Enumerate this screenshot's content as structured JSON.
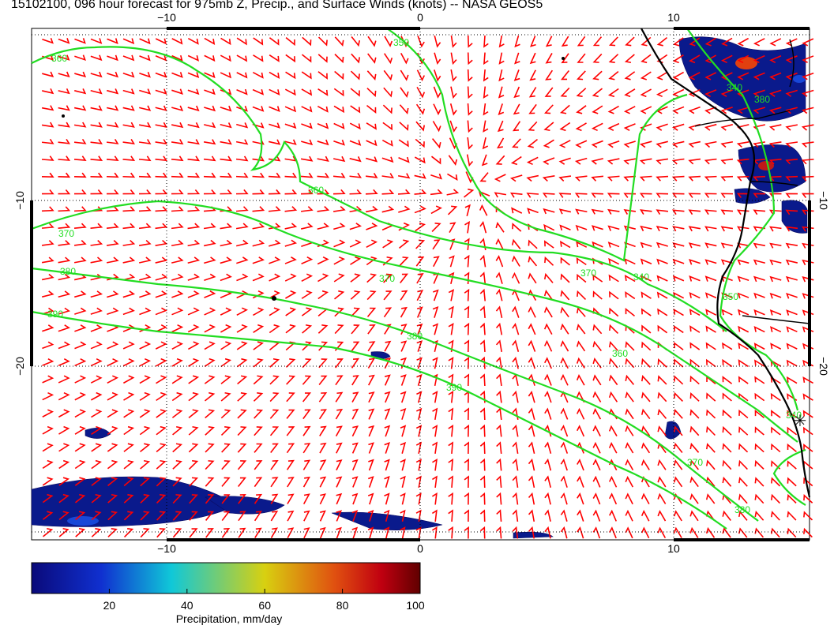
{
  "title": "15102100, 096 hour forecast for 975mb Z, Precip., and Surface Winds (knots) -- NASA GEOS5",
  "axes": {
    "lon_ticks": [
      "−10",
      "0",
      "10"
    ],
    "lat_ticks": [
      "−10",
      "−20"
    ]
  },
  "contour_labels": [
    "360",
    "350",
    "340",
    "380",
    "360",
    "370",
    "380",
    "390",
    "370",
    "380",
    "390",
    "370",
    "340",
    "360",
    "370",
    "380",
    "340",
    "350"
  ],
  "colorbar": {
    "label": "Precipitation, mm/day",
    "ticks": [
      "20",
      "40",
      "60",
      "80",
      "100"
    ]
  },
  "colors": {
    "contour": "#22dd22",
    "wind_barb": "#ff0000",
    "coastline": "#000000",
    "precip_low": "#0a1a8c"
  }
}
